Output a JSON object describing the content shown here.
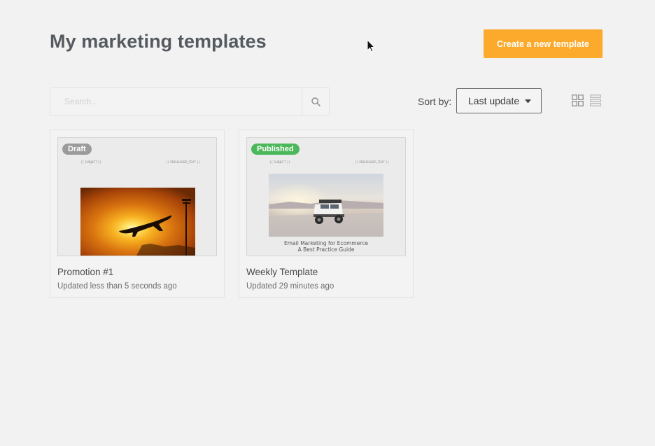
{
  "header": {
    "title": "My marketing templates",
    "create_button_label": "Create a new template"
  },
  "search": {
    "placeholder": "Search..."
  },
  "sort": {
    "label": "Sort by:",
    "selected": "Last update"
  },
  "view_toggle": {
    "grid_icon": "grid-icon",
    "list_icon": "list-icon"
  },
  "templates": [
    {
      "badge": "Draft",
      "name": "Promotion #1",
      "updated": "Updated less than 5 seconds ago",
      "thumb_left_text": "{{ SUBJECT }}",
      "thumb_right_text": "{{ PREHEADER_TEXT }}"
    },
    {
      "badge": "Published",
      "name": "Weekly Template",
      "updated": "Updated 29 minutes ago",
      "thumb_left_text": "{{ SUBJECT }}",
      "thumb_right_text": "{{ PREHEADER_TEXT }}",
      "caption_line_1": "Email Marketing for Ecommerce",
      "caption_line_2": "A Best Practice Guide"
    }
  ],
  "colors": {
    "background": "#f2f2f2",
    "accent": "#fbaa2c",
    "published": "#4cb85c",
    "draft": "#9b9b9b"
  }
}
